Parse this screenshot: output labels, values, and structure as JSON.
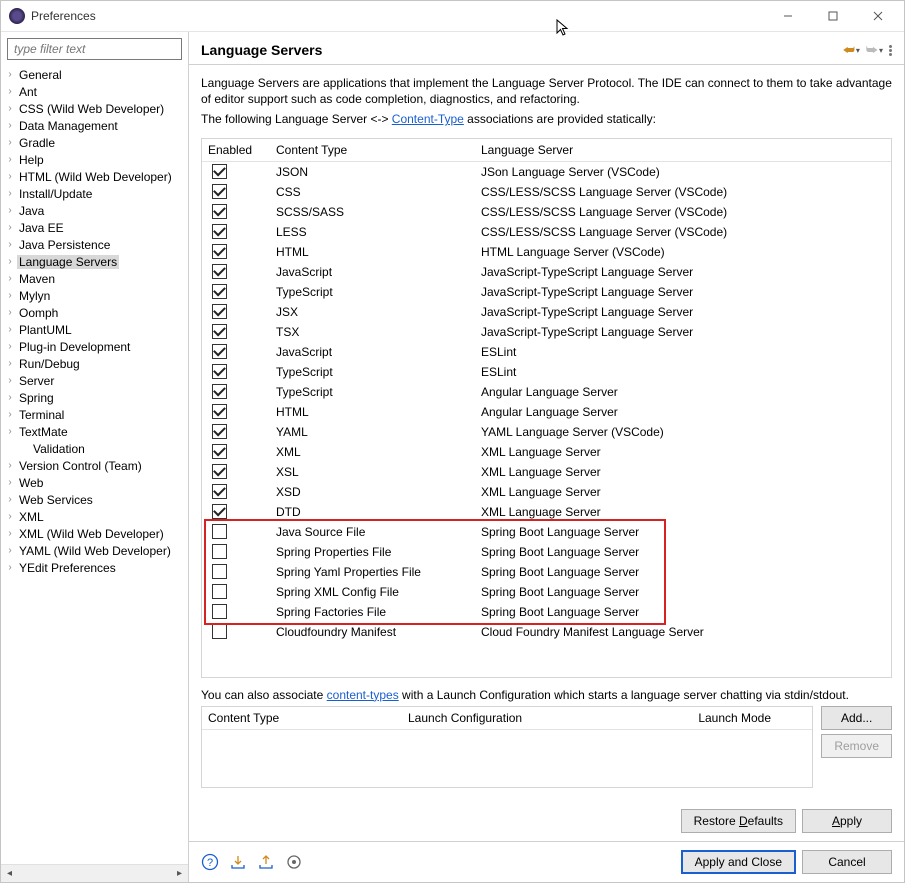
{
  "title": "Preferences",
  "filter_placeholder": "type filter text",
  "tree": [
    {
      "label": "General",
      "expandable": true
    },
    {
      "label": "Ant",
      "expandable": true
    },
    {
      "label": "CSS (Wild Web Developer)",
      "expandable": true
    },
    {
      "label": "Data Management",
      "expandable": true
    },
    {
      "label": "Gradle",
      "expandable": true
    },
    {
      "label": "Help",
      "expandable": true
    },
    {
      "label": "HTML (Wild Web Developer)",
      "expandable": true
    },
    {
      "label": "Install/Update",
      "expandable": true
    },
    {
      "label": "Java",
      "expandable": true
    },
    {
      "label": "Java EE",
      "expandable": true
    },
    {
      "label": "Java Persistence",
      "expandable": true
    },
    {
      "label": "Language Servers",
      "expandable": true,
      "selected": true
    },
    {
      "label": "Maven",
      "expandable": true
    },
    {
      "label": "Mylyn",
      "expandable": true
    },
    {
      "label": "Oomph",
      "expandable": true
    },
    {
      "label": "PlantUML",
      "expandable": true
    },
    {
      "label": "Plug-in Development",
      "expandable": true
    },
    {
      "label": "Run/Debug",
      "expandable": true
    },
    {
      "label": "Server",
      "expandable": true
    },
    {
      "label": "Spring",
      "expandable": true
    },
    {
      "label": "Terminal",
      "expandable": true
    },
    {
      "label": "TextMate",
      "expandable": true
    },
    {
      "label": "Validation",
      "expandable": false,
      "indent": true
    },
    {
      "label": "Version Control (Team)",
      "expandable": true
    },
    {
      "label": "Web",
      "expandable": true
    },
    {
      "label": "Web Services",
      "expandable": true
    },
    {
      "label": "XML",
      "expandable": true
    },
    {
      "label": "XML (Wild Web Developer)",
      "expandable": true
    },
    {
      "label": "YAML (Wild Web Developer)",
      "expandable": true
    },
    {
      "label": "YEdit Preferences",
      "expandable": true
    }
  ],
  "page_heading": "Language Servers",
  "intro": "Language Servers are applications that implement the Language Server Protocol. The IDE can connect to them to take advantage of editor support such as code completion, diagnostics, and refactoring.",
  "static_note_prefix": "The following Language Server <-> ",
  "content_type_link": "Content-Type",
  "static_note_suffix": " associations are provided statically:",
  "columns": {
    "enabled": "Enabled",
    "content_type": "Content Type",
    "language_server": "Language Server"
  },
  "rows": [
    {
      "checked": true,
      "type": "JSON",
      "server": "JSon Language Server (VSCode)"
    },
    {
      "checked": true,
      "type": "CSS",
      "server": "CSS/LESS/SCSS Language Server (VSCode)"
    },
    {
      "checked": true,
      "type": "SCSS/SASS",
      "server": "CSS/LESS/SCSS Language Server (VSCode)"
    },
    {
      "checked": true,
      "type": "LESS",
      "server": "CSS/LESS/SCSS Language Server (VSCode)"
    },
    {
      "checked": true,
      "type": "HTML",
      "server": "HTML Language Server (VSCode)"
    },
    {
      "checked": true,
      "type": "JavaScript",
      "server": "JavaScript-TypeScript Language Server"
    },
    {
      "checked": true,
      "type": "TypeScript",
      "server": "JavaScript-TypeScript Language Server"
    },
    {
      "checked": true,
      "type": "JSX",
      "server": "JavaScript-TypeScript Language Server"
    },
    {
      "checked": true,
      "type": "TSX",
      "server": "JavaScript-TypeScript Language Server"
    },
    {
      "checked": true,
      "type": "JavaScript",
      "server": "ESLint"
    },
    {
      "checked": true,
      "type": "TypeScript",
      "server": "ESLint"
    },
    {
      "checked": true,
      "type": "TypeScript",
      "server": "Angular Language Server"
    },
    {
      "checked": true,
      "type": "HTML",
      "server": "Angular Language Server"
    },
    {
      "checked": true,
      "type": "YAML",
      "server": "YAML Language Server (VSCode)"
    },
    {
      "checked": true,
      "type": "XML",
      "server": "XML Language Server"
    },
    {
      "checked": true,
      "type": "XSL",
      "server": "XML Language Server"
    },
    {
      "checked": true,
      "type": "XSD",
      "server": "XML Language Server"
    },
    {
      "checked": true,
      "type": "DTD",
      "server": "XML Language Server"
    },
    {
      "checked": false,
      "type": "Java Source File",
      "server": "Spring Boot Language Server"
    },
    {
      "checked": false,
      "type": "Spring Properties File",
      "server": "Spring Boot Language Server"
    },
    {
      "checked": false,
      "type": "Spring Yaml Properties File",
      "server": "Spring Boot Language Server"
    },
    {
      "checked": false,
      "type": "Spring XML Config File",
      "server": "Spring Boot Language Server"
    },
    {
      "checked": false,
      "type": "Spring Factories File",
      "server": "Spring Boot Language Server"
    },
    {
      "checked": false,
      "type": "Cloudfoundry Manifest",
      "server": "Cloud Foundry Manifest Language Server"
    }
  ],
  "assoc_note_prefix": "You can also associate ",
  "assoc_note_link": "content-types",
  "assoc_note_suffix": " with a Launch Configuration which starts a language server chatting via stdin/stdout.",
  "columns2": {
    "content_type": "Content Type",
    "launch_config": "Launch Configuration",
    "launch_mode": "Launch Mode"
  },
  "buttons": {
    "add": "Add...",
    "remove": "Remove",
    "restore_defaults_pre": "Restore ",
    "restore_defaults_u": "D",
    "restore_defaults_post": "efaults",
    "apply_u": "A",
    "apply_post": "pply",
    "apply_close": "Apply and Close",
    "cancel": "Cancel"
  }
}
